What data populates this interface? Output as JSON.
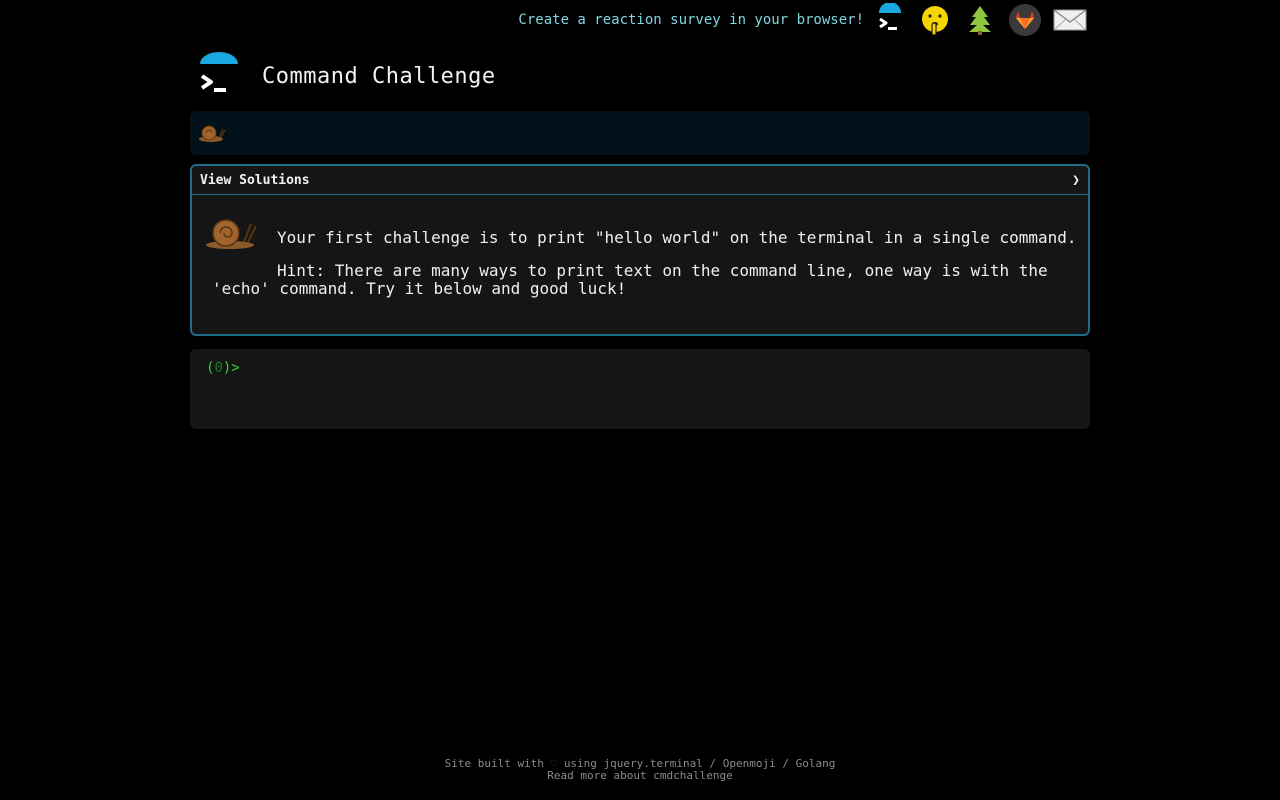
{
  "topbar": {
    "survey_link": "Create a reaction survey in your browser!",
    "icons": [
      "terminal-logo-icon",
      "shushing-face-icon",
      "tree-icon",
      "gitlab-icon",
      "envelope-icon"
    ]
  },
  "header": {
    "title": "Command Challenge"
  },
  "challenge": {
    "solutions_label": "View Solutions",
    "chevron": "❯",
    "text": "Your first challenge is to print \"hello world\" on the terminal in a single command.",
    "hint": "Hint: There are many ways to print text on the command line, one way is with the 'echo' command. Try it below and good luck!"
  },
  "terminal": {
    "prompt_open": "(",
    "prompt_count": "0",
    "prompt_close": ")>"
  },
  "footer": {
    "built_with": "Site built with",
    "heart": "♡",
    "using": "using",
    "link_jquery": "jquery.terminal",
    "sep1": "/",
    "link_openmoji": "Openmoji",
    "sep2": "/",
    "link_golang": "Golang",
    "read_more": "Read more about cmdchallenge"
  },
  "colors": {
    "background": "#000000",
    "accent": "#1f6c86",
    "survey_link": "#7fd6e0",
    "prompt": "#3ad23a"
  }
}
